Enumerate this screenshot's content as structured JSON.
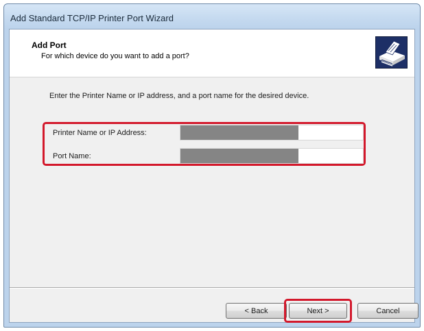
{
  "window": {
    "title": "Add Standard TCP/IP Printer Port Wizard"
  },
  "header": {
    "title": "Add Port",
    "subtitle": "For which device do you want to add a port?",
    "icon": "printer-port-icon"
  },
  "body": {
    "instruction": "Enter the Printer Name or IP address, and a port name for the desired device."
  },
  "fields": [
    {
      "label": "Printer Name or IP Address:",
      "value": ""
    },
    {
      "label": "Port Name:",
      "value": ""
    }
  ],
  "buttons": {
    "back": "< Back",
    "next": "Next >",
    "cancel": "Cancel"
  },
  "colors": {
    "highlight": "#d3182b",
    "icon_background": "#1d2f66",
    "title_bar": "#c4d9ef"
  }
}
